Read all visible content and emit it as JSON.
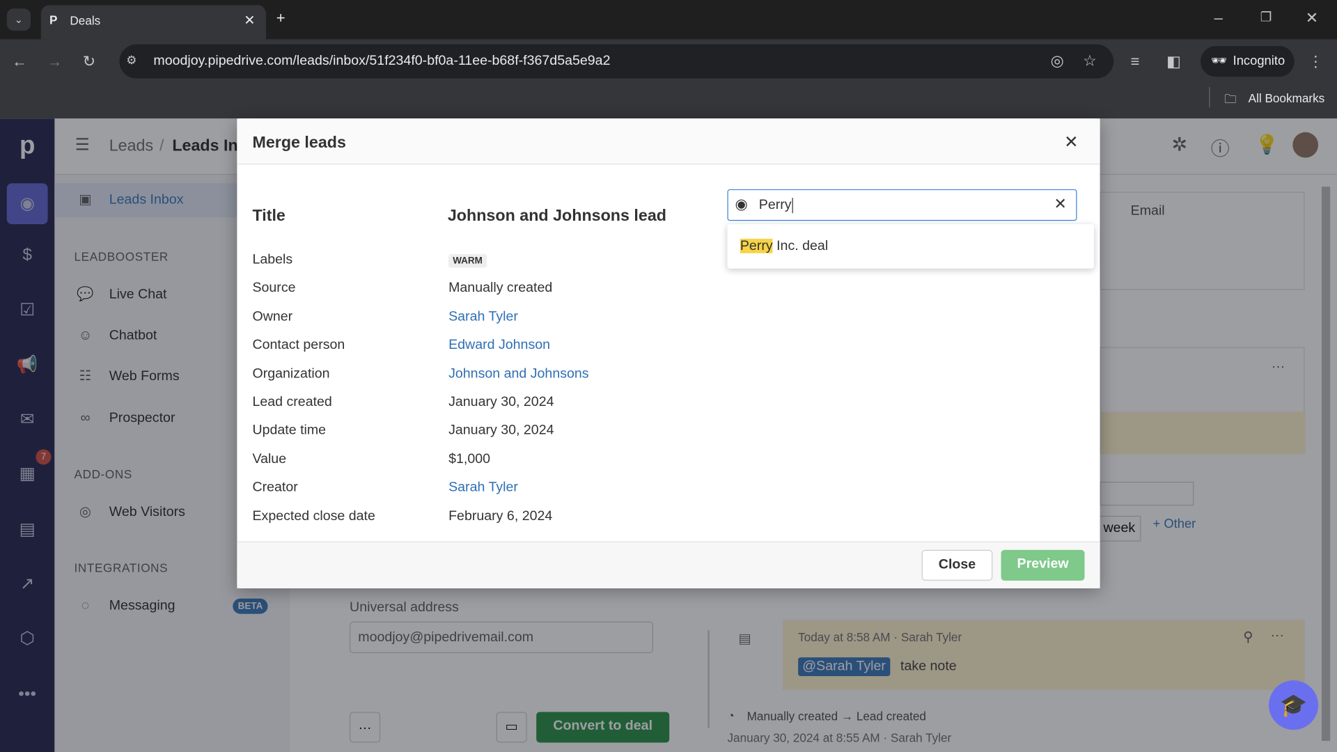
{
  "browser": {
    "tab_title": "Deals",
    "url": "moodjoy.pipedrive.com/leads/inbox/51f234f0-bf0a-11ee-b68f-f367d5a5e9a2",
    "incognito_label": "Incognito",
    "bookmarks_label": "All Bookmarks"
  },
  "header": {
    "breadcrumb_root": "Leads",
    "breadcrumb_current": "Leads Inbox"
  },
  "rail": {
    "badge_count": "7"
  },
  "sidebar": {
    "active": "Leads Inbox",
    "sections": [
      {
        "title": "LEADBOOSTER",
        "items": [
          "Live Chat",
          "Chatbot",
          "Web Forms",
          "Prospector"
        ]
      },
      {
        "title": "ADD-ONS",
        "items": [
          "Web Visitors"
        ]
      },
      {
        "title": "INTEGRATIONS",
        "items": [
          "Messaging"
        ]
      }
    ],
    "beta_badge": "BETA"
  },
  "background": {
    "email_tab": "Email",
    "week_label": "week",
    "other_label": "+ Other",
    "universal_address_label": "Universal address",
    "universal_address_value": "moodjoy@pipedrivemail.com",
    "convert_button": "Convert to deal",
    "note_meta": "Today at 8:58 AM · Sarah Tyler",
    "mention": "@Sarah Tyler",
    "note_text": "take note",
    "history_text": "Manually created → Lead created",
    "history_meta": "January 30, 2024 at 8:55 AM · Sarah Tyler"
  },
  "modal": {
    "title": "Merge leads",
    "lead_title_label": "Title",
    "lead_title_value": "Johnson and Johnsons lead",
    "fields": [
      {
        "label": "Labels",
        "value": "WARM",
        "type": "badge"
      },
      {
        "label": "Source",
        "value": "Manually created",
        "type": "text"
      },
      {
        "label": "Owner",
        "value": "Sarah Tyler",
        "type": "link"
      },
      {
        "label": "Contact person",
        "value": "Edward Johnson",
        "type": "link"
      },
      {
        "label": "Organization",
        "value": "Johnson and Johnsons",
        "type": "link"
      },
      {
        "label": "Lead created",
        "value": "January 30, 2024",
        "type": "text"
      },
      {
        "label": "Update time",
        "value": "January 30, 2024",
        "type": "text"
      },
      {
        "label": "Value",
        "value": "$1,000",
        "type": "text"
      },
      {
        "label": "Creator",
        "value": "Sarah Tyler",
        "type": "link"
      },
      {
        "label": "Expected close date",
        "value": "February 6, 2024",
        "type": "text"
      }
    ],
    "search_value": "Perry",
    "suggestion_match": "Perry",
    "suggestion_rest": " Inc. deal",
    "close_button": "Close",
    "preview_button": "Preview"
  },
  "colors": {
    "accent_green": "#7fc98a",
    "link_blue": "#2f6fb5",
    "highlight": "#f7d347",
    "rail": "#1b1d45"
  }
}
